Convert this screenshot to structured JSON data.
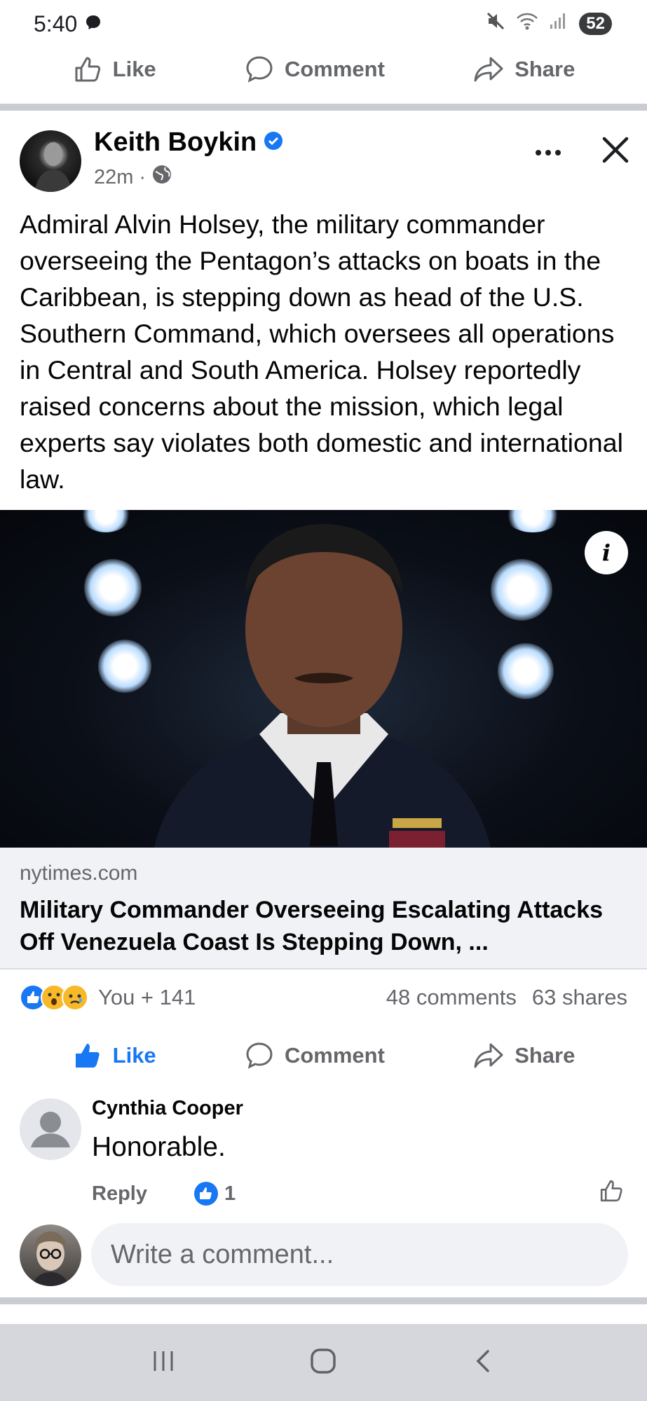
{
  "status_bar": {
    "time": "5:40",
    "battery": "52",
    "icons": [
      "messenger-bubble-icon",
      "mute-icon",
      "wifi-icon",
      "signal-icon"
    ]
  },
  "top_actions": {
    "like": "Like",
    "comment": "Comment",
    "share": "Share"
  },
  "post": {
    "author": "Keith Boykin",
    "verified": true,
    "time": "22m",
    "separator": "·",
    "audience_icon": "globe-icon",
    "text": "Admiral Alvin Holsey, the military commander overseeing the Pentagon’s attacks on boats in the Caribbean, is stepping down as head of the U.S. Southern Command, which oversees all operations in Central and South America. Holsey reportedly raised concerns about the mission, which legal experts say violates both domestic and international law.",
    "image_info_label": "i",
    "link": {
      "domain": "nytimes.com",
      "title": "Military Commander Overseeing Escalating Attacks Off Venezuela Coast Is Stepping Down, ..."
    },
    "reactions": {
      "icons": [
        "like",
        "wow",
        "sad"
      ],
      "summary": "You + 141",
      "comments": "48 comments",
      "shares": "63 shares"
    },
    "actions": {
      "like": "Like",
      "comment": "Comment",
      "share": "Share",
      "like_active": true
    }
  },
  "comment": {
    "author": "Cynthia Cooper",
    "text": "Honorable.",
    "reply": "Reply",
    "like_count": "1"
  },
  "composer": {
    "placeholder": "Write a comment..."
  },
  "colors": {
    "facebook_blue": "#1877f2",
    "secondary_text": "#65676b",
    "surface": "#f0f2f5"
  },
  "nav_bar": {
    "icons": [
      "recent-apps-icon",
      "home-icon",
      "back-icon"
    ]
  }
}
